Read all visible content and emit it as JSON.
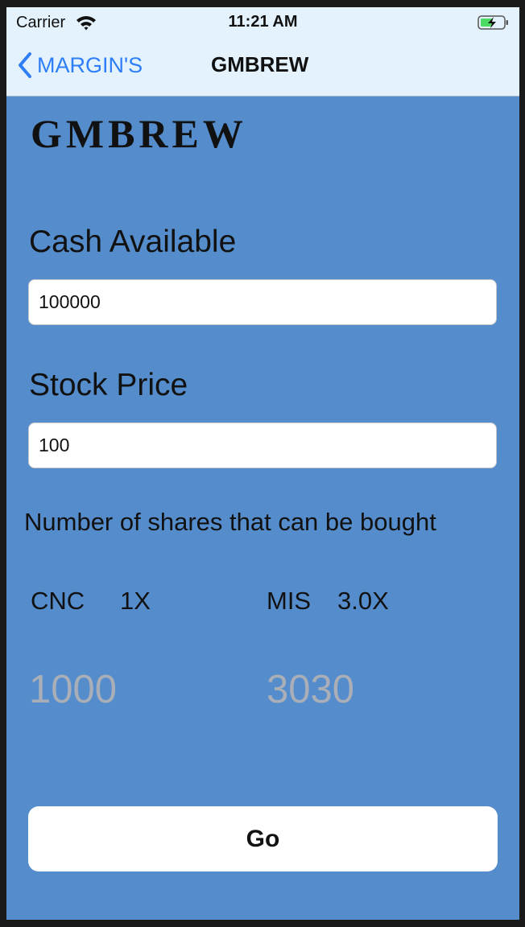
{
  "status_bar": {
    "carrier": "Carrier",
    "time": "11:21 AM"
  },
  "nav": {
    "back_label": "MARGIN'S",
    "title": "GMBREW"
  },
  "content": {
    "brand": "GMBREW",
    "cash_label": "Cash Available",
    "cash_value": "100000",
    "price_label": "Stock Price",
    "price_value": "100",
    "shares_heading": "Number of shares that can be bought",
    "cnc_label": "CNC",
    "cnc_multiplier": "1X",
    "mis_label": "MIS",
    "mis_multiplier": "3.0X",
    "cnc_shares": "1000",
    "mis_shares": "3030",
    "go_label": "Go"
  },
  "colors": {
    "background": "#558dcc",
    "nav_background": "#e3f2fd",
    "accent": "#2d7ef7",
    "result_text": "#a9aeb7"
  }
}
